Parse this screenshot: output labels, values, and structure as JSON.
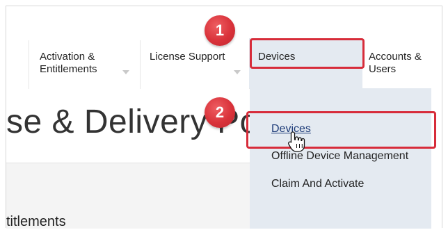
{
  "nav": {
    "items": [
      {
        "label_line1": "Activation &",
        "label_line2": "Entitlements"
      },
      {
        "label_line1": "License Support",
        "label_line2": ""
      },
      {
        "label_line1": "Devices",
        "label_line2": ""
      },
      {
        "label_line1": "Accounts &",
        "label_line2": "Users"
      }
    ]
  },
  "hero": {
    "title": "se & Delivery Po"
  },
  "section": {
    "title": "titlements"
  },
  "dropdown": {
    "items": [
      {
        "label": "Devices"
      },
      {
        "label": "Offline Device Management"
      },
      {
        "label": "Claim And Activate"
      }
    ]
  },
  "badges": {
    "step1": "1",
    "step2": "2"
  },
  "colors": {
    "highlight": "#d72c3a",
    "menu_bg": "#e4eaf1",
    "link": "#1d3b78"
  }
}
